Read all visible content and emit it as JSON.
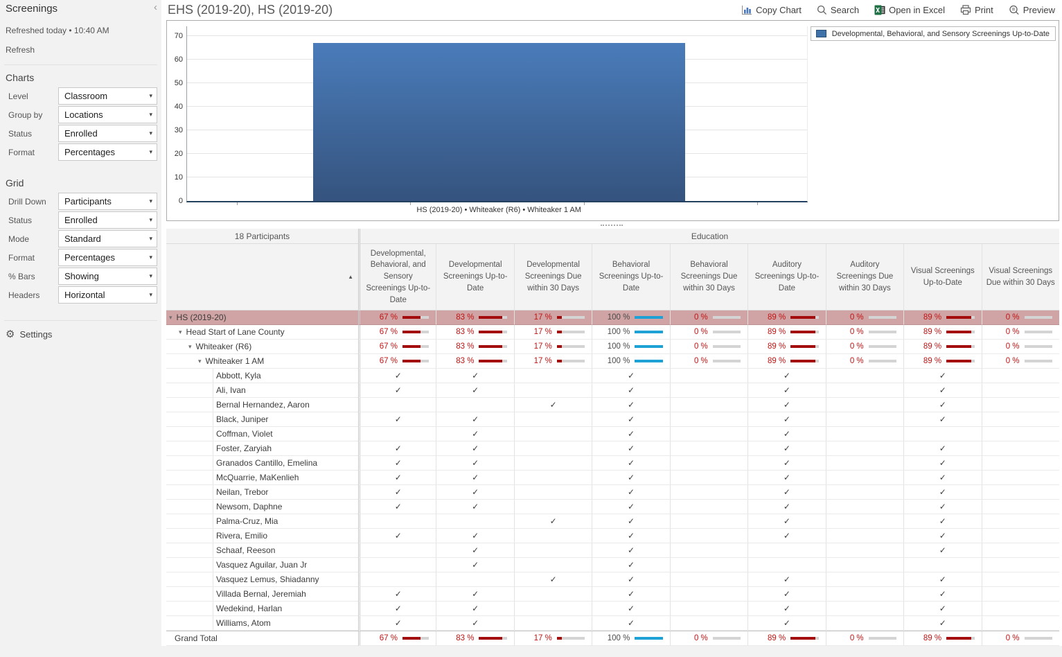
{
  "icons": {
    "chevron_left": "‹",
    "caret_down": "▾",
    "check": "✓",
    "gear": "⚙",
    "sort_asc": "▲",
    "expander": "▾"
  },
  "sidebar": {
    "title": "Screenings",
    "refreshed": "Refreshed today • 10:40 AM",
    "refresh_label": "Refresh",
    "charts_section": {
      "heading": "Charts",
      "fields": [
        {
          "label": "Level",
          "value": "Classroom"
        },
        {
          "label": "Group by",
          "value": "Locations"
        },
        {
          "label": "Status",
          "value": "Enrolled"
        },
        {
          "label": "Format",
          "value": "Percentages"
        }
      ]
    },
    "grid_section": {
      "heading": "Grid",
      "fields": [
        {
          "label": "Drill Down",
          "value": "Participants"
        },
        {
          "label": "Status",
          "value": "Enrolled"
        },
        {
          "label": "Mode",
          "value": "Standard"
        },
        {
          "label": "Format",
          "value": "Percentages"
        },
        {
          "label": "% Bars",
          "value": "Showing"
        },
        {
          "label": "Headers",
          "value": "Horizontal"
        }
      ]
    },
    "settings_label": "Settings"
  },
  "header": {
    "title": "EHS (2019-20), HS (2019-20)",
    "toolbar": [
      {
        "label": "Copy Chart",
        "icon": "chart-icon"
      },
      {
        "label": "Search",
        "icon": "search-icon"
      },
      {
        "label": "Open in Excel",
        "icon": "excel-icon"
      },
      {
        "label": "Print",
        "icon": "print-icon"
      },
      {
        "label": "Preview",
        "icon": "preview-icon"
      }
    ]
  },
  "chart_data": {
    "type": "bar",
    "categories": [
      "HS (2019-20) • Whiteaker (R6) • Whiteaker 1 AM"
    ],
    "values": [
      67
    ],
    "title": "",
    "xlabel": "",
    "ylabel": "",
    "ylim": [
      0,
      70
    ],
    "ytick_step": 10,
    "grid": true,
    "legend_position": "top-right",
    "legend": [
      "Developmental, Behavioral, and Sensory Screenings Up-to-Date"
    ],
    "bar_color_top": "#4a7cba",
    "bar_color_bottom": "#35537e"
  },
  "grid": {
    "participants_header": "18 Participants",
    "group_header": "Education",
    "columns": [
      "Developmental, Behavioral, and Sensory Screenings Up-to-Date",
      "Developmental Screenings Up-to-Date",
      "Developmental Screenings Due within 30 Days",
      "Behavioral Screenings Up-to-Date",
      "Behavioral Screenings Due within 30 Days",
      "Auditory Screenings Up-to-Date",
      "Auditory Screenings Due within 30 Days",
      "Visual Screenings Up-to-Date",
      "Visual Screenings Due within 30 Days"
    ],
    "summary_rows": [
      {
        "label": "HS (2019-20)",
        "indent": 0,
        "highlighted": true,
        "values": [
          67,
          83,
          17,
          100,
          0,
          89,
          0,
          89,
          0
        ]
      },
      {
        "label": "Head Start of Lane County",
        "indent": 1,
        "highlighted": false,
        "values": [
          67,
          83,
          17,
          100,
          0,
          89,
          0,
          89,
          0
        ]
      },
      {
        "label": "Whiteaker (R6)",
        "indent": 2,
        "highlighted": false,
        "values": [
          67,
          83,
          17,
          100,
          0,
          89,
          0,
          89,
          0
        ]
      },
      {
        "label": "Whiteaker 1 AM",
        "indent": 3,
        "highlighted": false,
        "values": [
          67,
          83,
          17,
          100,
          0,
          89,
          0,
          89,
          0
        ]
      }
    ],
    "participants": [
      {
        "name": "Abbott, Kyla",
        "checks": [
          1,
          1,
          0,
          1,
          0,
          1,
          0,
          1,
          0
        ]
      },
      {
        "name": "Ali, Ivan",
        "checks": [
          1,
          1,
          0,
          1,
          0,
          1,
          0,
          1,
          0
        ]
      },
      {
        "name": "Bernal Hernandez, Aaron",
        "checks": [
          0,
          0,
          1,
          1,
          0,
          1,
          0,
          1,
          0
        ]
      },
      {
        "name": "Black, Juniper",
        "checks": [
          1,
          1,
          0,
          1,
          0,
          1,
          0,
          1,
          0
        ]
      },
      {
        "name": "Coffman, Violet",
        "checks": [
          0,
          1,
          0,
          1,
          0,
          1,
          0,
          0,
          0
        ]
      },
      {
        "name": "Foster, Zaryiah",
        "checks": [
          1,
          1,
          0,
          1,
          0,
          1,
          0,
          1,
          0
        ]
      },
      {
        "name": "Granados Cantillo, Emelina",
        "checks": [
          1,
          1,
          0,
          1,
          0,
          1,
          0,
          1,
          0
        ]
      },
      {
        "name": "McQuarrie, MaKenlieh",
        "checks": [
          1,
          1,
          0,
          1,
          0,
          1,
          0,
          1,
          0
        ]
      },
      {
        "name": "Neilan, Trebor",
        "checks": [
          1,
          1,
          0,
          1,
          0,
          1,
          0,
          1,
          0
        ]
      },
      {
        "name": "Newsom, Daphne",
        "checks": [
          1,
          1,
          0,
          1,
          0,
          1,
          0,
          1,
          0
        ]
      },
      {
        "name": "Palma-Cruz, Mia",
        "checks": [
          0,
          0,
          1,
          1,
          0,
          1,
          0,
          1,
          0
        ]
      },
      {
        "name": "Rivera, Emilio",
        "checks": [
          1,
          1,
          0,
          1,
          0,
          1,
          0,
          1,
          0
        ]
      },
      {
        "name": "Schaaf, Reeson",
        "checks": [
          0,
          1,
          0,
          1,
          0,
          0,
          0,
          1,
          0
        ]
      },
      {
        "name": "Vasquez Aguilar, Juan Jr",
        "checks": [
          0,
          1,
          0,
          1,
          0,
          0,
          0,
          0,
          0
        ]
      },
      {
        "name": "Vasquez Lemus, Shiadanny",
        "checks": [
          0,
          0,
          1,
          1,
          0,
          1,
          0,
          1,
          0
        ]
      },
      {
        "name": "Villada Bernal, Jeremiah",
        "checks": [
          1,
          1,
          0,
          1,
          0,
          1,
          0,
          1,
          0
        ]
      },
      {
        "name": "Wedekind, Harlan",
        "checks": [
          1,
          1,
          0,
          1,
          0,
          1,
          0,
          1,
          0
        ]
      },
      {
        "name": "Williams, Atom",
        "checks": [
          1,
          1,
          0,
          1,
          0,
          1,
          0,
          1,
          0
        ]
      }
    ],
    "grand_total": {
      "label": "Grand Total",
      "values": [
        67,
        83,
        17,
        100,
        0,
        89,
        0,
        89,
        0
      ]
    },
    "colors": {
      "highlight_bg": "#d0a3a4",
      "pct_red_text": "#c01414",
      "pct_gray_text": "#4a4a4a",
      "bar_red": "#a40b0d",
      "bar_blue": "#1ea2d6",
      "bar_track": "#d4d4d4"
    }
  }
}
